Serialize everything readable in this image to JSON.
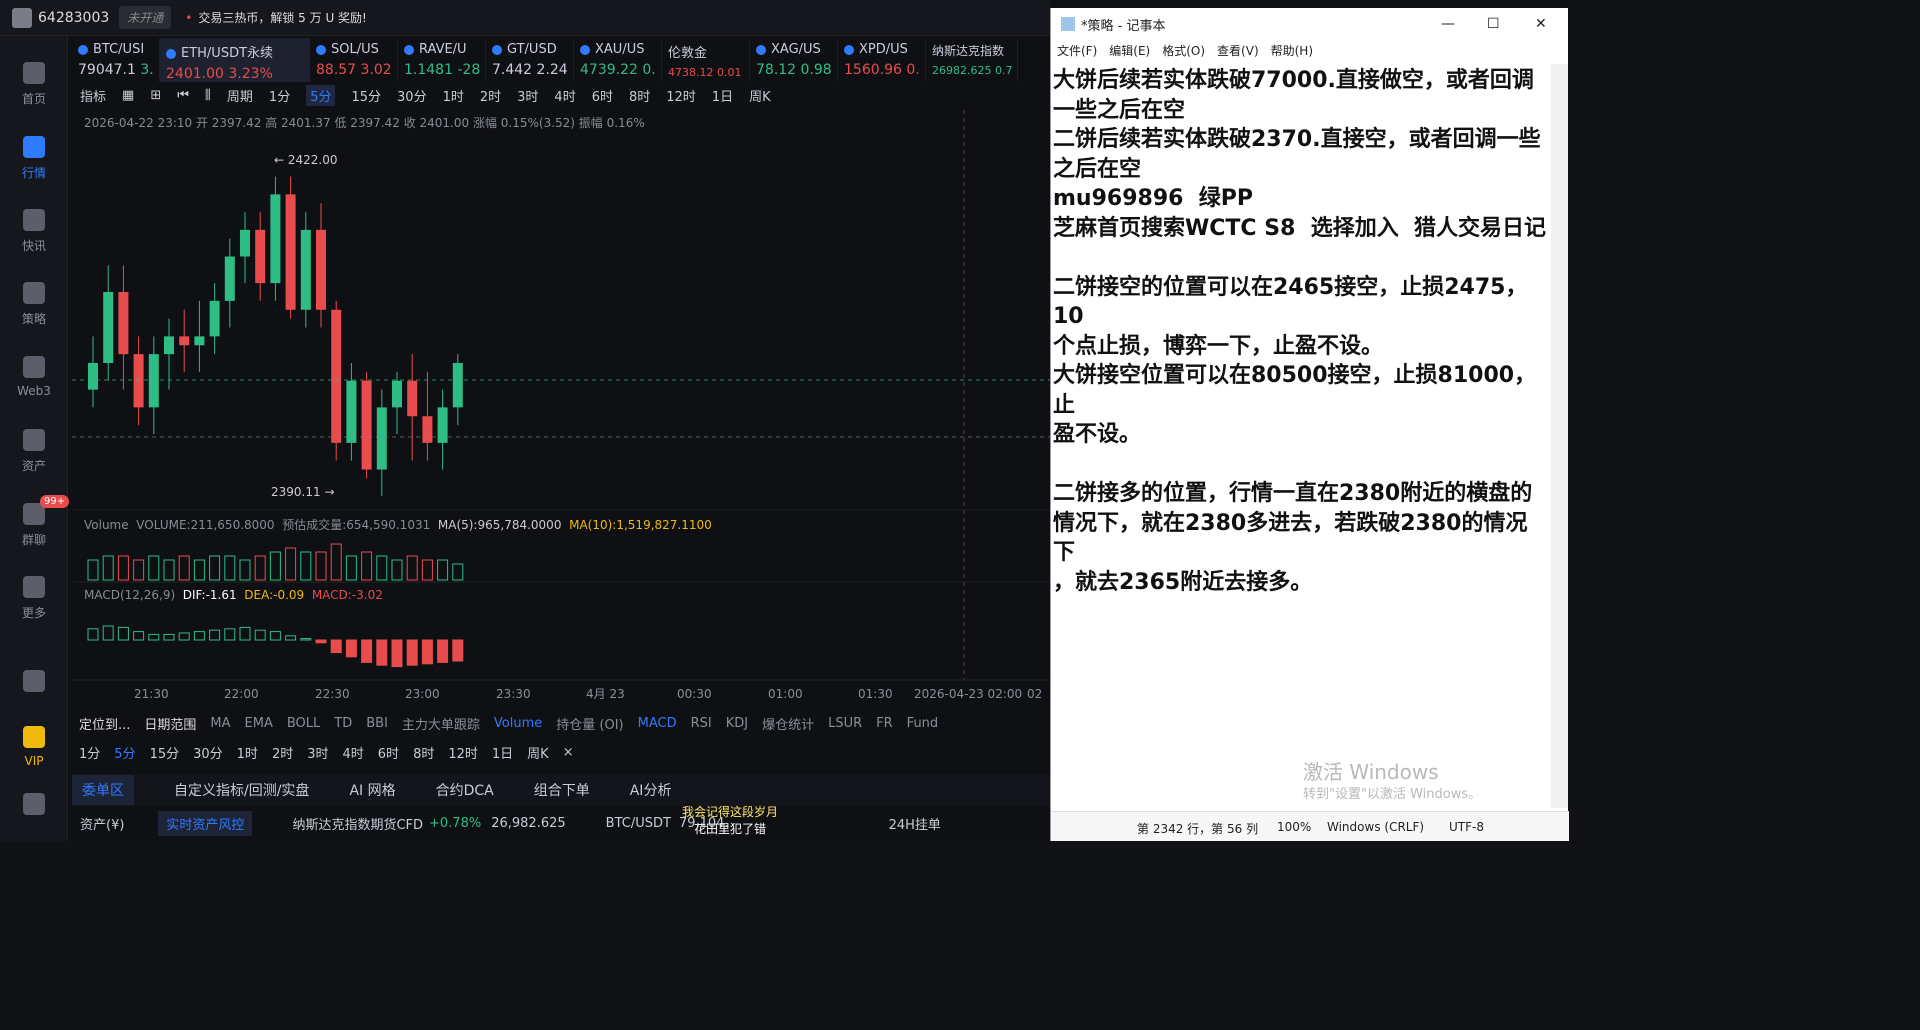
{
  "topbar": {
    "account": "64283003",
    "not_open": "未开通",
    "promo": "交易三热币，解锁 5 万 U 奖励!"
  },
  "sidebar": [
    {
      "label": "首页",
      "icon": "home-icon"
    },
    {
      "label": "行情",
      "icon": "chart-icon"
    },
    {
      "label": "快讯",
      "icon": "news-icon"
    },
    {
      "label": "策略",
      "icon": "robot-icon"
    },
    {
      "label": "Web3",
      "icon": "web3-icon"
    },
    {
      "label": "资产",
      "icon": "wallet-icon"
    },
    {
      "label": "群聊",
      "icon": "chat-icon",
      "badge": "99+"
    },
    {
      "label": "更多",
      "icon": "more-icon"
    },
    {
      "label": "",
      "icon": "phone-icon"
    },
    {
      "label": "VIP",
      "icon": "vip-icon"
    },
    {
      "label": "",
      "icon": "settings-icon"
    }
  ],
  "tickers": [
    {
      "name": "BTC/USI",
      "price": "79047.1",
      "chg": "3."
    },
    {
      "name": "ETH/USDT永续",
      "price": "2401.00",
      "chg": "3.23%"
    },
    {
      "name": "SOL/US",
      "price": "88.57",
      "chg": "3.02"
    },
    {
      "name": "RAVE/U",
      "price": "1.1481",
      "chg": "-28"
    },
    {
      "name": "GT/USD",
      "price": "7.442",
      "chg": "2.24"
    },
    {
      "name": "XAU/US",
      "price": "4739.22",
      "chg": "0."
    },
    {
      "name": "伦敦金",
      "price": "4738.12",
      "chg": "0.01"
    },
    {
      "name": "XAG/US",
      "price": "78.12",
      "chg": "0.98"
    },
    {
      "name": "XPD/US",
      "price": "1560.96",
      "chg": "0."
    },
    {
      "name": "纳斯达克指数",
      "price": "26982.625",
      "chg": "0.7"
    }
  ],
  "toolbar": {
    "indicator": "指标",
    "period": "周期",
    "periods": [
      "1分",
      "5分",
      "15分",
      "30分",
      "1时",
      "2时",
      "3时",
      "4时",
      "6时",
      "8时",
      "12时",
      "1日",
      "周K"
    ],
    "active": "5分"
  },
  "candle_info": "2026-04-22 23:10  开 2397.42  高 2401.37  低 2397.42  收 2401.00  涨幅 0.15%(3.52)  振幅 0.16%",
  "labels": {
    "high": "← 2422.00",
    "low": "2390.11 →"
  },
  "volume_info": {
    "label": "Volume",
    "vol": "VOLUME:211,650.8000",
    "est": "预估成交量:654,590.1031",
    "ma5": "MA(5):965,784.0000",
    "ma10": "MA(10):1,519,827.1100"
  },
  "macd_info": {
    "label": "MACD(12,26,9)",
    "dif": "DIF:-1.61",
    "dea": "DEA:-0.09",
    "macd": "MACD:-3.02"
  },
  "time_axis": [
    "21:30",
    "22:00",
    "22:30",
    "23:00",
    "23:30",
    "4月 23",
    "00:30",
    "01:00",
    "01:30",
    "2026-04-23 02:00",
    "02"
  ],
  "ind_row": [
    "定位到...",
    "日期范围",
    "MA",
    "EMA",
    "BOLL",
    "TD",
    "BBI",
    "主力大单跟踪",
    "Volume",
    "持仓量 (OI)",
    "MACD",
    "RSI",
    "KDJ",
    "爆仓统计",
    "LSUR",
    "FR",
    "Fund"
  ],
  "per_row": [
    "1分",
    "5分",
    "15分",
    "30分",
    "1时",
    "2时",
    "3时",
    "4时",
    "6时",
    "8时",
    "12时",
    "1日",
    "周K",
    "×"
  ],
  "bottom_tabs": [
    "委单区",
    "自定义指标/回测/实盘",
    "AI 网格",
    "合约DCA",
    "组合下单",
    "AI分析"
  ],
  "status": {
    "assets": "资产(¥)",
    "risk": "实时资产风控",
    "nas": "纳斯达克指数期货CFD",
    "nas_chg": "+0.78%",
    "nas_price": "26,982.625",
    "btc": "BTC/USDT",
    "btc_price": "79,104.",
    "song": "我会记得这段岁月",
    "song2": "花田里犯了错",
    "hang": "24H挂单"
  },
  "notepad": {
    "title": "*策略 - 记事本",
    "menu": [
      "文件(F)",
      "编辑(E)",
      "格式(O)",
      "查看(V)",
      "帮助(H)"
    ],
    "text": "大饼后续若实体跌破77000.直接做空，或者回调\n一些之后在空\n二饼后续若实体跌破2370.直接空，或者回调一些\n之后在空\nmu969896  绿PP\n芝麻首页搜索WCTC S8  选择加入  猎人交易日记\n\n二饼接空的位置可以在2465接空，止损2475，10\n个点止损，博弈一下，止盈不设。\n大饼接空位置可以在80500接空，止损81000，止\n盈不设。\n\n二饼接多的位置，行情一直在2380附近的横盘的\n情况下，就在2380多进去，若跌破2380的情况下\n，就去2365附近去接多。",
    "status_pos": "第 2342 行，第 56 列",
    "zoom": "100%",
    "eol": "Windows (CRLF)",
    "enc": "UTF-8",
    "watermark": "激活 Windows",
    "watermark2": "转到\"设置\"以激活 Windows。"
  },
  "chart_data": {
    "type": "candlestick",
    "symbol": "ETH/USDT",
    "interval": "5分",
    "ohlc": [
      [
        2398,
        2404,
        2396,
        2401
      ],
      [
        2401,
        2412,
        2399,
        2409
      ],
      [
        2409,
        2412,
        2398,
        2402
      ],
      [
        2402,
        2404,
        2394,
        2396
      ],
      [
        2396,
        2404,
        2393,
        2402
      ],
      [
        2402,
        2406,
        2398,
        2404
      ],
      [
        2404,
        2407,
        2400,
        2403
      ],
      [
        2403,
        2408,
        2400,
        2404
      ],
      [
        2404,
        2410,
        2402,
        2408
      ],
      [
        2408,
        2415,
        2405,
        2413
      ],
      [
        2413,
        2418,
        2410,
        2416
      ],
      [
        2416,
        2418,
        2408,
        2410
      ],
      [
        2410,
        2422,
        2408,
        2420
      ],
      [
        2420,
        2422,
        2406,
        2407
      ],
      [
        2407,
        2418,
        2405,
        2416
      ],
      [
        2416,
        2419,
        2405,
        2407
      ],
      [
        2407,
        2408,
        2390,
        2392
      ],
      [
        2392,
        2401,
        2390,
        2399
      ],
      [
        2399,
        2400,
        2388,
        2389
      ],
      [
        2389,
        2398,
        2386,
        2396
      ],
      [
        2396,
        2400,
        2393,
        2399
      ],
      [
        2399,
        2402,
        2390,
        2395
      ],
      [
        2395,
        2400,
        2390,
        2392
      ],
      [
        2392,
        2398,
        2389,
        2396
      ],
      [
        2396,
        2402,
        2394,
        2401
      ]
    ],
    "volume": [
      5,
      6,
      6,
      5,
      6,
      5,
      6,
      5,
      6,
      6,
      5,
      6,
      7,
      8,
      7,
      7,
      9,
      6,
      7,
      6,
      5,
      6,
      5,
      5,
      4
    ],
    "macd": [
      0.8,
      1.0,
      0.9,
      0.6,
      0.4,
      0.4,
      0.5,
      0.6,
      0.7,
      0.8,
      0.9,
      0.7,
      0.6,
      0.3,
      0.1,
      -0.2,
      -0.9,
      -1.2,
      -1.6,
      -1.8,
      -1.9,
      -1.8,
      -1.7,
      -1.6,
      -1.5
    ]
  }
}
